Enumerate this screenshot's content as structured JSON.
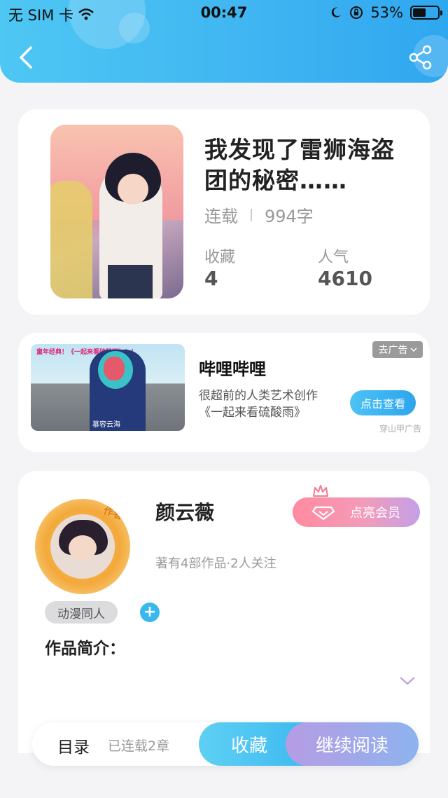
{
  "status_bar": {
    "carrier": "无 SIM 卡",
    "time": "00:47",
    "battery_percent": "53%",
    "battery_level": 0.53
  },
  "header": {
    "back_icon": "chevron-left-icon",
    "share_icon": "share-icon"
  },
  "book": {
    "title": "我发现了雷狮海盗团的秘密……",
    "status": "连载",
    "word_count": "994字",
    "favorites_label": "收藏",
    "favorites_value": "4",
    "popularity_label": "人气",
    "popularity_value": "4610"
  },
  "ad": {
    "thumb_banner": "童年经典！《一起来看硫酸雨》！！",
    "thumb_caption": "慕容云海",
    "title": "哔哩哔哩",
    "description_line1": "很超前的人类艺术创作",
    "description_line2": "《一起来看硫酸雨》",
    "button_label": "点击查看",
    "tag_label": "去广告",
    "source": "穿山甲广告"
  },
  "author": {
    "avatar_tag": "作者",
    "name": "颜云薇",
    "meta": "著有4部作品·2人关注",
    "vip_button": "点亮会员",
    "tag": "动漫同人",
    "add_tag": "+",
    "intro_label": "作品简介："
  },
  "bottom_bar": {
    "toc_label": "目录",
    "toc_count": "已连载2章",
    "favorite_button": "收藏",
    "continue_button": "继续阅读"
  },
  "colors": {
    "header_gradient_start": "#4ec7f3",
    "header_gradient_end": "#2fa7ef",
    "accent_blue": "#36b5ef",
    "vip_pink": "#ff8aa0",
    "vip_purple": "#c4a0e8"
  }
}
